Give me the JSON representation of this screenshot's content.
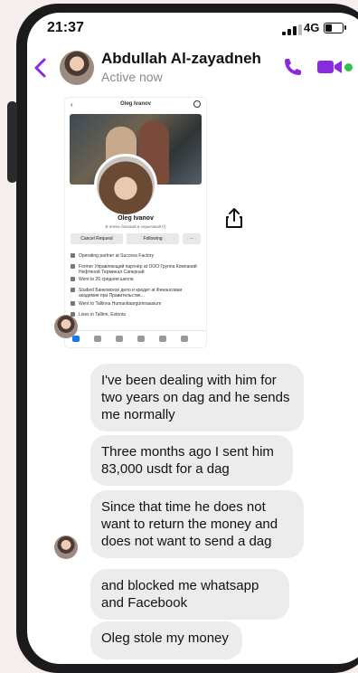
{
  "status_bar": {
    "time": "21:37",
    "network": "4G"
  },
  "chat_header": {
    "name": "Abdullah Al-zayadneh",
    "status": "Active now"
  },
  "shared_screenshot": {
    "title": "Oleg Ivanov",
    "profile_name": "Oleg Ivanov",
    "profile_subtitle": "В очень близкой и серьезный (!)",
    "buttons": {
      "cancel": "Cancel Request",
      "following": "Following",
      "more": "···"
    },
    "info": [
      "Operating partner at Success Factory",
      "Former Управляющий партнёр at ООО Группа Компаний Нефтяной Терминал Сапернай",
      "Went to 26 средняя школа",
      "Studied Банковское дело и кредит at Финансовая академия при Правительстве...",
      "Went to Tallinna Humanitaargümnaasium",
      "Lives in Tallinn, Estonia"
    ]
  },
  "messages": [
    {
      "text": "I've been dealing with him for two years on dag and he sends me normally"
    },
    {
      "text": "Three months ago I sent him 83,000 usdt for a dag"
    },
    {
      "text": "Since that time he does not want to return the money and does not want to send a dag"
    },
    {
      "text": "and blocked me whatsapp and Facebook"
    },
    {
      "text": "Oleg stole my money"
    }
  ],
  "colors": {
    "accent": "#8a2be2",
    "online": "#31c24d",
    "bubble": "#ececec"
  }
}
